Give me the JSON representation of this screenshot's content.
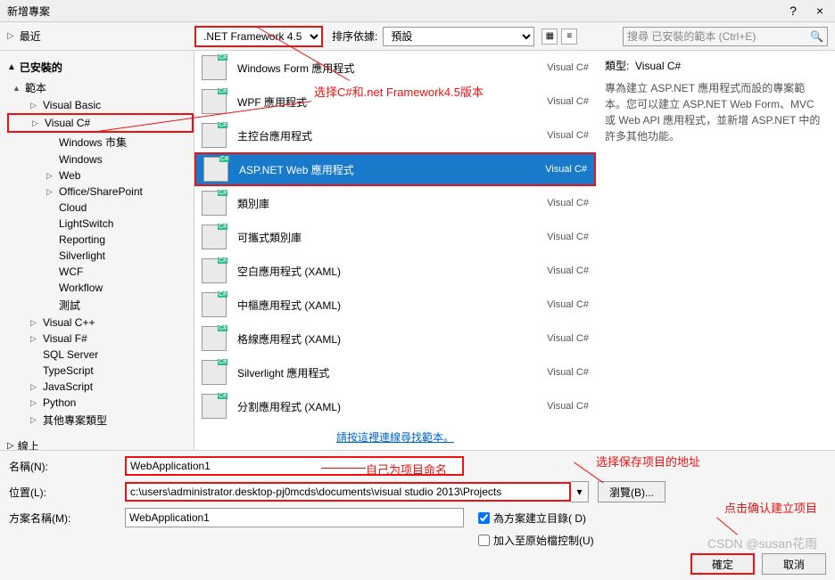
{
  "window": {
    "title": "新增專案",
    "help": "?",
    "close": "×"
  },
  "toolbar": {
    "recent_label": "最近",
    "framework": ".NET Framework 4.5",
    "sort_label": "排序依據:",
    "sort_value": "預設",
    "search_placeholder": "搜尋 已安裝的範本 (Ctrl+E)"
  },
  "tree": {
    "installed_label": "已安裝的",
    "templates_label": "範本",
    "items": [
      {
        "label": "Visual Basic",
        "arrow": true,
        "lvl": 2
      },
      {
        "label": "Visual C#",
        "arrow": true,
        "lvl": 2,
        "sel": true
      },
      {
        "label": "Windows 市集",
        "lvl": 3
      },
      {
        "label": "Windows",
        "lvl": 3
      },
      {
        "label": "Web",
        "arrow": true,
        "lvl": 3
      },
      {
        "label": "Office/SharePoint",
        "arrow": true,
        "lvl": 3
      },
      {
        "label": "Cloud",
        "lvl": 3
      },
      {
        "label": "LightSwitch",
        "lvl": 3
      },
      {
        "label": "Reporting",
        "lvl": 3
      },
      {
        "label": "Silverlight",
        "lvl": 3
      },
      {
        "label": "WCF",
        "lvl": 3
      },
      {
        "label": "Workflow",
        "lvl": 3
      },
      {
        "label": "測試",
        "lvl": 3
      },
      {
        "label": "Visual C++",
        "arrow": true,
        "lvl": 2
      },
      {
        "label": "Visual F#",
        "arrow": true,
        "lvl": 2
      },
      {
        "label": "SQL Server",
        "lvl": 2
      },
      {
        "label": "TypeScript",
        "lvl": 2
      },
      {
        "label": "JavaScript",
        "arrow": true,
        "lvl": 2
      },
      {
        "label": "Python",
        "arrow": true,
        "lvl": 2
      },
      {
        "label": "其他專案類型",
        "arrow": true,
        "lvl": 2
      }
    ],
    "online_label": "線上"
  },
  "templates": [
    {
      "name": "Windows Form 應用程式",
      "lang": "Visual C#"
    },
    {
      "name": "WPF 應用程式",
      "lang": "Visual C#"
    },
    {
      "name": "主控台應用程式",
      "lang": "Visual C#"
    },
    {
      "name": "ASP.NET Web 應用程式",
      "lang": "Visual C#",
      "sel": true
    },
    {
      "name": "類別庫",
      "lang": "Visual C#"
    },
    {
      "name": "可攜式類別庫",
      "lang": "Visual C#"
    },
    {
      "name": "空白應用程式 (XAML)",
      "lang": "Visual C#"
    },
    {
      "name": "中樞應用程式 (XAML)",
      "lang": "Visual C#"
    },
    {
      "name": "格線應用程式 (XAML)",
      "lang": "Visual C#"
    },
    {
      "name": "Silverlight 應用程式",
      "lang": "Visual C#"
    },
    {
      "name": "分割應用程式 (XAML)",
      "lang": "Visual C#"
    }
  ],
  "go_online": "請按這裡連線尋找範本。",
  "desc": {
    "type_label": "類型:",
    "type_value": "Visual C#",
    "text": "專為建立 ASP.NET 應用程式而設的專案範本。您可以建立 ASP.NET Web Form、MVC 或 Web API 應用程式，並新增 ASP.NET 中的許多其他功能。"
  },
  "form": {
    "name_label": "名稱(N):",
    "name_value": "WebApplication1",
    "loc_label": "位置(L):",
    "loc_value": "c:\\users\\administrator.desktop-pj0mcds\\documents\\visual studio 2013\\Projects",
    "browse": "瀏覽(B)...",
    "sol_label": "方案名稱(M):",
    "sol_value": "WebApplication1",
    "chk1": "為方案建立目錄( D)",
    "chk2": "加入至原始檔控制(U)",
    "ok": "確定",
    "cancel": "取消"
  },
  "annotations": {
    "a1": "选择C#和.net Framework4.5版本",
    "a2": "自己为项目命名",
    "a3": "选择保存项目的地址",
    "a4": "点击确认建立项目"
  },
  "watermark": "CSDN @susan花雨"
}
